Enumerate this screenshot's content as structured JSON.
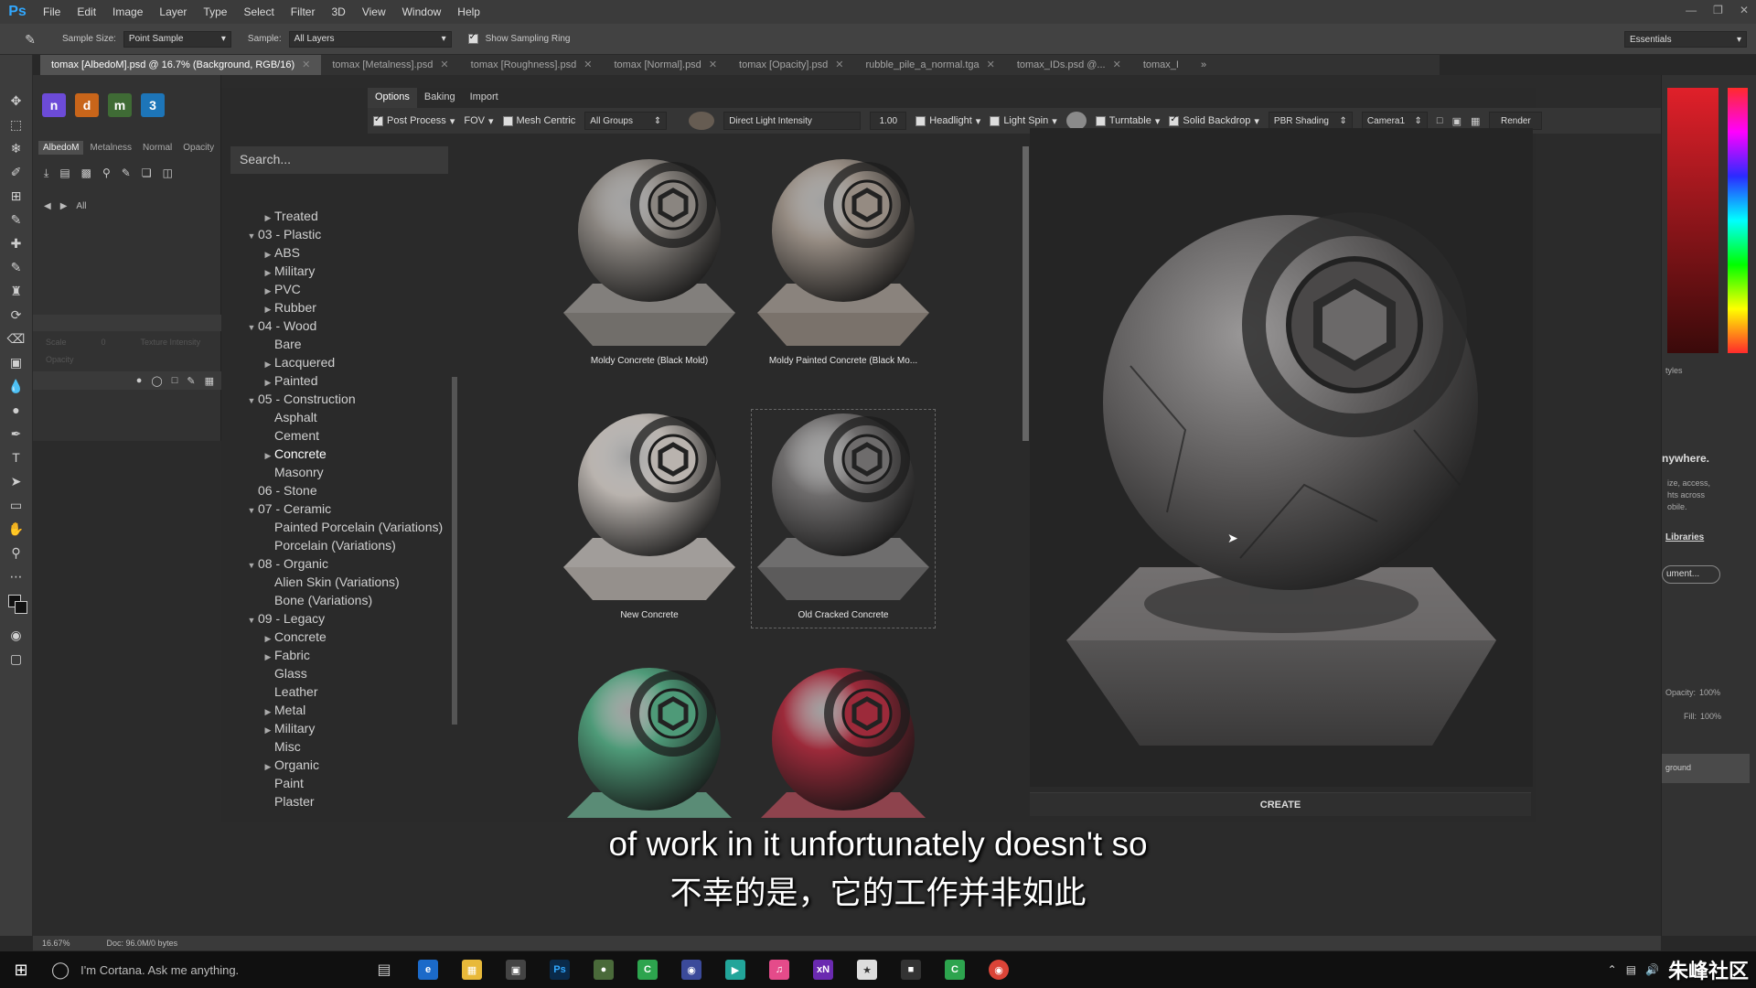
{
  "app": {
    "logo": "Ps",
    "menu": [
      "File",
      "Edit",
      "Image",
      "Layer",
      "Type",
      "Select",
      "Filter",
      "3D",
      "View",
      "Window",
      "Help"
    ],
    "workspace": "Essentials"
  },
  "options_bar": {
    "sample_size_label": "Sample Size:",
    "sample_size_value": "Point Sample",
    "sample_label": "Sample:",
    "sample_value": "All Layers",
    "show_sampling_ring": "Show Sampling Ring"
  },
  "doc_tabs": [
    "tomax [AlbedoM].psd @ 16.7% (Background, RGB/16)",
    "tomax [Metalness].psd",
    "tomax [Roughness].psd",
    "tomax [Normal].psd",
    "tomax [Opacity].psd",
    "rubble_pile_a_normal.tga",
    "tomax_IDs.psd @...",
    "tomax_I"
  ],
  "left_panel": {
    "channel_tabs": [
      "AlbedoM",
      "Metalness",
      "Normal",
      "Opacity"
    ],
    "breadcrumb": "All",
    "scale_label": "Scale",
    "scale_value": "0",
    "texture_intensity": "Texture Intensity",
    "opacity_label": "Opacity"
  },
  "plugin": {
    "tabs": [
      "Options",
      "Baking",
      "Import"
    ],
    "opts": {
      "post_process": "Post Process",
      "fov": "FOV",
      "mesh_centric": "Mesh Centric",
      "all_groups": "All Groups",
      "direct_light": "Direct Light Intensity",
      "intensity_value": "1.00",
      "headlight": "Headlight",
      "light_spin": "Light Spin",
      "turntable": "Turntable",
      "solid_backdrop": "Solid Backdrop",
      "shading": "PBR Shading",
      "camera": "Camera1",
      "render": "Render"
    },
    "search_placeholder": "Search...",
    "tree": [
      {
        "label": "Treated",
        "level": 2,
        "arrow": "right"
      },
      {
        "label": "03 - Plastic",
        "level": 1,
        "arrow": "down"
      },
      {
        "label": "ABS",
        "level": 2,
        "arrow": "right"
      },
      {
        "label": "Military",
        "level": 2,
        "arrow": "right"
      },
      {
        "label": "PVC",
        "level": 2,
        "arrow": "right"
      },
      {
        "label": "Rubber",
        "level": 2,
        "arrow": "right"
      },
      {
        "label": "04 - Wood",
        "level": 1,
        "arrow": "down"
      },
      {
        "label": "Bare",
        "level": 2,
        "arrow": ""
      },
      {
        "label": "Lacquered",
        "level": 2,
        "arrow": "right"
      },
      {
        "label": "Painted",
        "level": 2,
        "arrow": "right"
      },
      {
        "label": "05 - Construction",
        "level": 1,
        "arrow": "down"
      },
      {
        "label": "Asphalt",
        "level": 2,
        "arrow": ""
      },
      {
        "label": "Cement",
        "level": 2,
        "arrow": ""
      },
      {
        "label": "Concrete",
        "level": 2,
        "arrow": "right",
        "selected": true
      },
      {
        "label": "Masonry",
        "level": 2,
        "arrow": ""
      },
      {
        "label": "06 - Stone",
        "level": 1,
        "arrow": ""
      },
      {
        "label": "07 - Ceramic",
        "level": 1,
        "arrow": "down"
      },
      {
        "label": "Painted Porcelain (Variations)",
        "level": 2,
        "arrow": ""
      },
      {
        "label": "Porcelain (Variations)",
        "level": 2,
        "arrow": ""
      },
      {
        "label": "08 - Organic",
        "level": 1,
        "arrow": "down"
      },
      {
        "label": "Alien Skin (Variations)",
        "level": 2,
        "arrow": ""
      },
      {
        "label": "Bone (Variations)",
        "level": 2,
        "arrow": ""
      },
      {
        "label": "09 - Legacy",
        "level": 1,
        "arrow": "down"
      },
      {
        "label": "Concrete",
        "level": 2,
        "arrow": "right"
      },
      {
        "label": "Fabric",
        "level": 2,
        "arrow": "right"
      },
      {
        "label": "Glass",
        "level": 2,
        "arrow": ""
      },
      {
        "label": "Leather",
        "level": 2,
        "arrow": ""
      },
      {
        "label": "Metal",
        "level": 2,
        "arrow": "right"
      },
      {
        "label": "Military",
        "level": 2,
        "arrow": "right"
      },
      {
        "label": "Misc",
        "level": 2,
        "arrow": ""
      },
      {
        "label": "Organic",
        "level": 2,
        "arrow": "right"
      },
      {
        "label": "Paint",
        "level": 2,
        "arrow": ""
      },
      {
        "label": "Plaster",
        "level": 2,
        "arrow": ""
      }
    ],
    "materials": [
      {
        "label": "Moldy Concrete (Black Mold)",
        "color": "#8a8580"
      },
      {
        "label": "Moldy Painted Concrete (Black Mo...",
        "color": "#958b82"
      },
      {
        "label": "New Concrete",
        "color": "#b9b3ae"
      },
      {
        "label": "Old Cracked Concrete",
        "color": "#6e6c6c"
      },
      {
        "label": "",
        "color": "#4e9a78"
      },
      {
        "label": "",
        "color": "#9c2a3a"
      }
    ],
    "create_label": "CREATE"
  },
  "right_panel": {
    "styles": "tyles",
    "anywhere": "nywhere.",
    "lib_text_1": "ize, access,",
    "lib_text_2": "hts across",
    "lib_text_3": "obile.",
    "libraries_link": "Libraries",
    "document_btn": "ument...",
    "opacity_label": "Opacity:",
    "opacity_value": "100%",
    "fill_label": "Fill:",
    "fill_value": "100%",
    "layer_name": "ground"
  },
  "status": {
    "zoom": "16.67%",
    "doc": "Doc: 96.0M/0 bytes"
  },
  "subtitle": {
    "en": "of work in it unfortunately doesn't so",
    "zh": "不幸的是，它的工作并非如此"
  },
  "taskbar": {
    "cortana": "I'm Cortana. Ask me anything.",
    "watermark": "朱峰社区"
  }
}
